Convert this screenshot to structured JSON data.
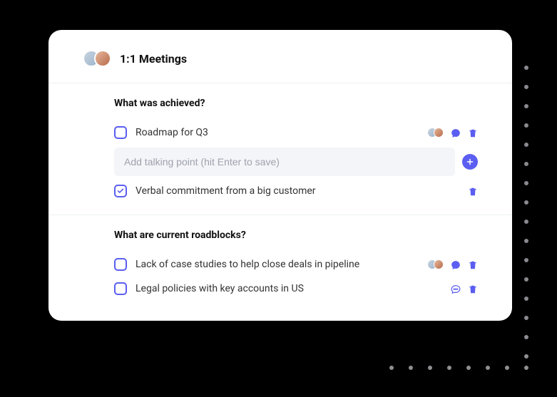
{
  "header": {
    "title": "1:1 Meetings"
  },
  "sections": [
    {
      "title": "What was achieved?",
      "items": [
        {
          "text": "Roadmap for Q3",
          "checked": false,
          "showAvatars": true,
          "chat": "filled",
          "trash": true
        },
        {
          "text": "Verbal commitment from a big customer",
          "checked": true,
          "showAvatars": false,
          "chat": null,
          "trash": true
        }
      ],
      "input_placeholder": "Add talking point (hit Enter to save)"
    },
    {
      "title": "What are current roadblocks?",
      "items": [
        {
          "text": "Lack of case studies to help close deals in pipeline",
          "checked": false,
          "showAvatars": true,
          "chat": "filled",
          "trash": true
        },
        {
          "text": "Legal policies with key accounts in US",
          "checked": false,
          "showAvatars": false,
          "chat": "outline",
          "trash": true
        }
      ]
    }
  ]
}
